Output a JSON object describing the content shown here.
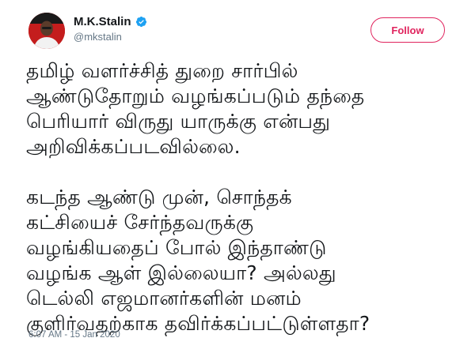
{
  "user": {
    "display_name": "M.K.Stalin",
    "handle": "@mkstalin",
    "verified": true
  },
  "follow_label": "Follow",
  "tweet": {
    "paragraphs": [
      [
        "தமிழ் வளர்ச்சித் துறை சார்பில்",
        "ஆண்டுதோறும் வழங்கப்படும் தந்தை",
        "பெரியார் விருது யாருக்கு என்பது",
        "அறிவிக்கப்படவில்லை."
      ],
      [
        "கடந்த ஆண்டு முன், சொந்தக்",
        "கட்சியைச் சேர்ந்தவருக்கு",
        "வழங்கியதைப் போல் இந்தாண்டு",
        "வழங்க ஆள் இல்லையா? அல்லது",
        "டெல்லி எஜமானர்களின் மனம்",
        "குளிர்வதற்காக தவிர்க்கப்பட்டுள்ளதா?"
      ]
    ]
  },
  "timestamp": "6:07 AM - 15 Jan 2020",
  "colors": {
    "follow_accent": "#e0245e",
    "verified_blue": "#1da1f2",
    "secondary_text": "#657786",
    "avatar_bg": "#c41d1d"
  },
  "icons": {
    "verified": "verified-badge-icon"
  }
}
